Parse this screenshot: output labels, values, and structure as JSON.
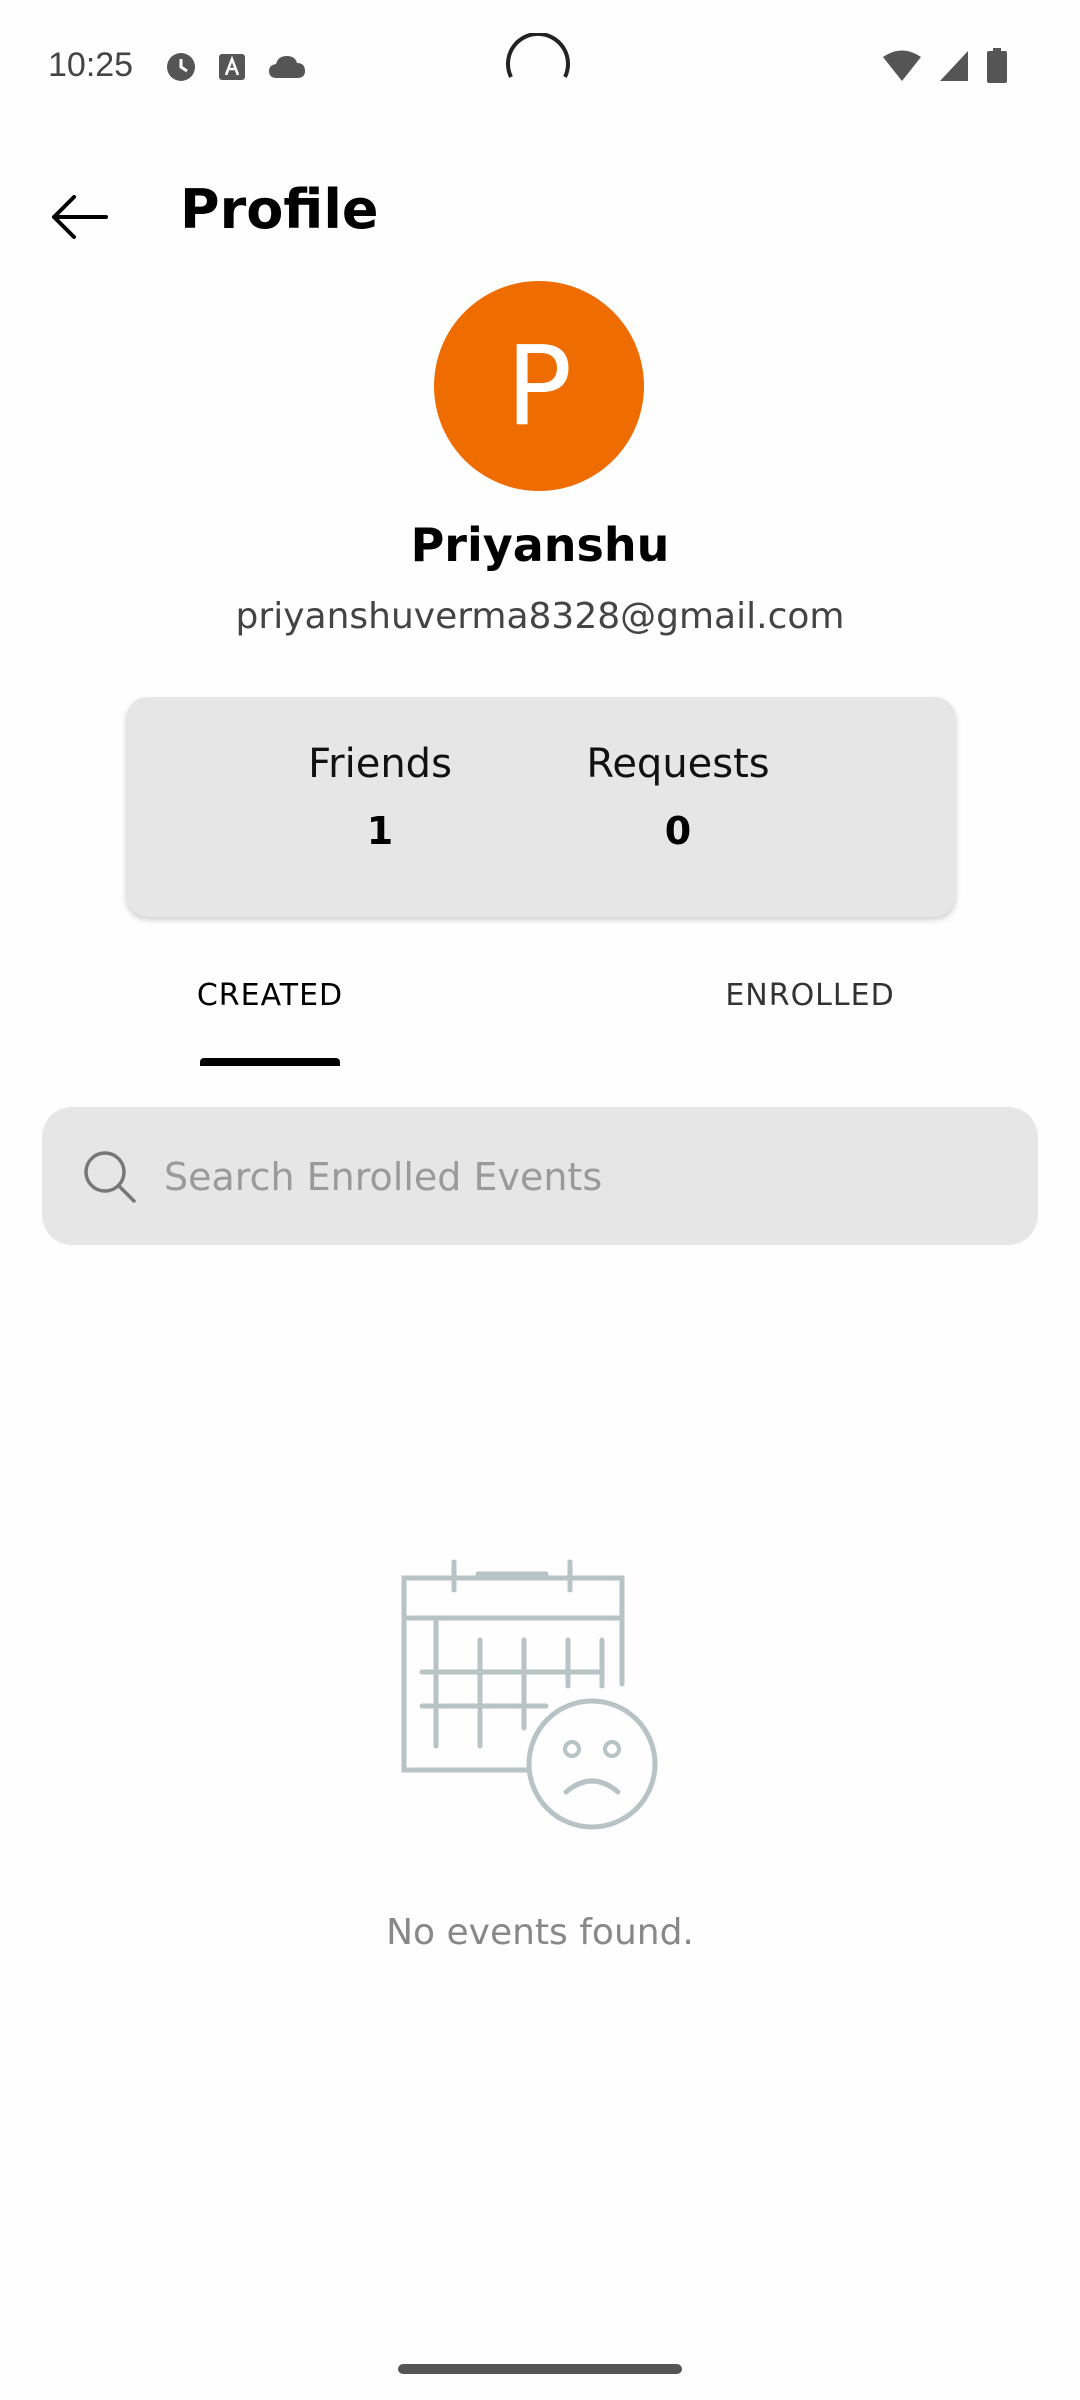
{
  "status_bar": {
    "time": "10:25",
    "left_icons": [
      "clock-icon",
      "a-icon",
      "cloud-icon"
    ],
    "right_icons": [
      "wifi-icon",
      "signal-icon",
      "battery-icon"
    ]
  },
  "header": {
    "back_icon": "arrow-left-icon",
    "title": "Profile"
  },
  "profile": {
    "avatar_letter": "P",
    "avatar_color": "#ef6c00",
    "name": "Priyanshu",
    "email": "priyanshuverma8328@gmail.com"
  },
  "stats": {
    "friends_label": "Friends",
    "friends_value": "1",
    "requests_label": "Requests",
    "requests_value": "0"
  },
  "tabs": [
    {
      "label": "CREATED",
      "active": true
    },
    {
      "label": "ENROLLED",
      "active": false
    }
  ],
  "search": {
    "icon": "search-icon",
    "placeholder": "Search Enrolled Events",
    "value": ""
  },
  "empty_state": {
    "icon": "calendar-sad-icon",
    "message": "No events found."
  }
}
